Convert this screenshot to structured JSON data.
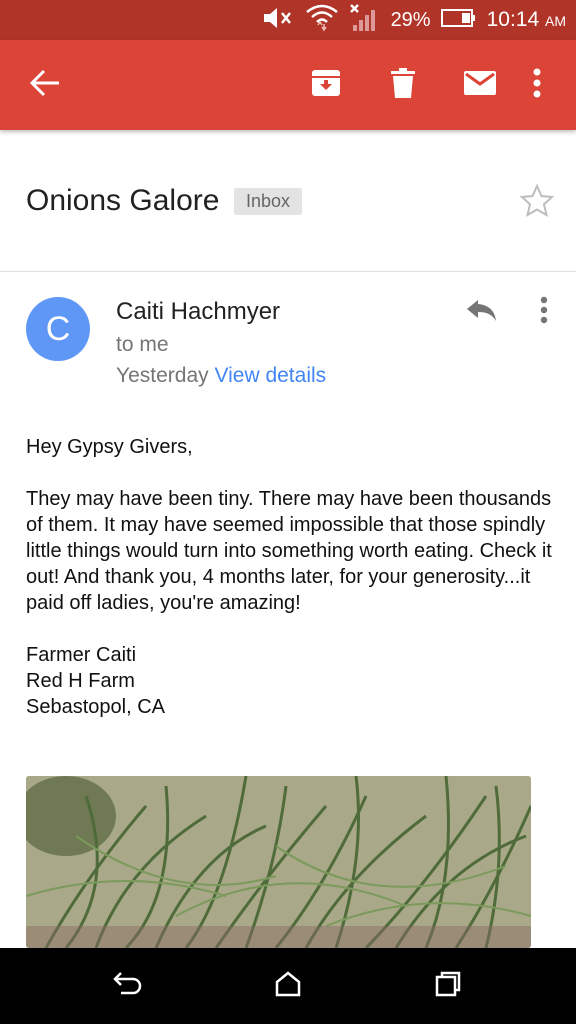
{
  "status_bar": {
    "battery_percent": "29%",
    "time": "10:14",
    "time_suffix": "AM"
  },
  "app_bar": {
    "back_icon": "arrow-left-icon",
    "archive_icon": "archive-icon",
    "delete_icon": "trash-icon",
    "mark_unread_icon": "mail-icon",
    "overflow_icon": "more-vert-icon"
  },
  "email": {
    "subject": "Onions Galore",
    "label": "Inbox",
    "sender_initial": "C",
    "sender_name": "Caiti Hachmyer",
    "recipient": "to me",
    "date": "Yesterday",
    "view_details": "View details",
    "body": {
      "greeting": "Hey Gypsy Givers,",
      "paragraph": "They may have been tiny. There may have been thousands of them. It may have seemed impossible that those spindly little things would turn into something worth eating. Check it out! And thank you, 4 months later, for your generosity...it paid off ladies, you're amazing!",
      "signature_lines": [
        "Farmer Caiti",
        "Red H Farm",
        "Sebastopol, CA"
      ]
    },
    "avatar_color": "#5e97f6"
  },
  "colors": {
    "app_bar": "#db4437",
    "status_bar": "#b03427",
    "link": "#4285f4"
  }
}
